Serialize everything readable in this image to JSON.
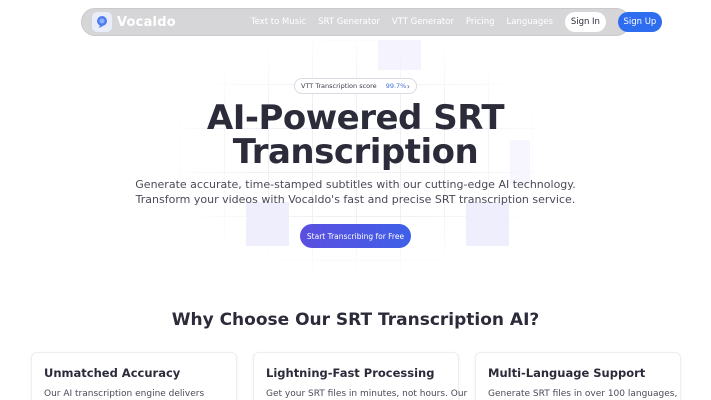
{
  "nav": {
    "brand": "Vocaldo",
    "links": [
      "Text to Music",
      "SRT Generator",
      "VTT Generator",
      "Pricing",
      "Languages"
    ],
    "sign_in": "Sign In",
    "sign_up": "Sign Up"
  },
  "hero": {
    "badge_label": "VTT Transcription score",
    "badge_score": "99.7%",
    "title_line1": "AI-Powered SRT",
    "title_line2": "Transcription",
    "subtitle_line1": "Generate accurate, time-stamped subtitles with our cutting-edge AI technology.",
    "subtitle_line2": "Transform your videos with Vocaldo's fast and precise SRT transcription service.",
    "cta": "Start Transcribing for Free"
  },
  "why": {
    "title": "Why Choose Our SRT Transcription AI?",
    "cards": [
      {
        "title": "Unmatched Accuracy",
        "text": "Our AI transcription engine delivers"
      },
      {
        "title": "Lightning-Fast Processing",
        "text": "Get your SRT files in minutes, not hours. Our"
      },
      {
        "title": "Multi-Language Support",
        "text": "Generate SRT files in over 100 languages,"
      }
    ]
  },
  "colors": {
    "accent": "#2f6df0",
    "cta_start": "#5b4fe0",
    "cta_end": "#3f5fe8",
    "nav_bg": "#d6d6d9"
  }
}
